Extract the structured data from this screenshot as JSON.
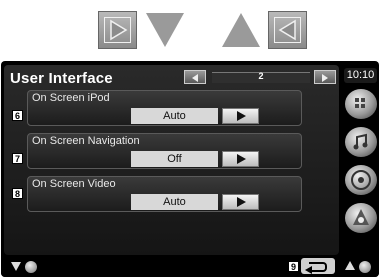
{
  "screen": {
    "title": "User Interface",
    "page_number": "2",
    "clock": "10:10"
  },
  "settings": [
    {
      "badge": "6",
      "label": "On Screen iPod",
      "value": "Auto"
    },
    {
      "badge": "7",
      "label": "On Screen Navigation",
      "value": "Off"
    },
    {
      "badge": "8",
      "label": "On Screen Video",
      "value": "Auto"
    }
  ],
  "return_badge": "9",
  "icons": {
    "manual_next": "play-right-icon",
    "manual_down": "triangle-down-icon",
    "manual_up": "triangle-up-icon",
    "manual_prev": "play-left-icon",
    "side_1": "menu-grid-icon",
    "side_2": "media-icon",
    "side_3": "disc-icon",
    "side_4": "settings-icon",
    "return": "return-arrow-icon"
  },
  "colors": {
    "screen_bg": "#000000",
    "panel_bg": "#1e1e1e",
    "value_bg": "#d8d8d8",
    "manual_gray": "#9a9a9a"
  }
}
